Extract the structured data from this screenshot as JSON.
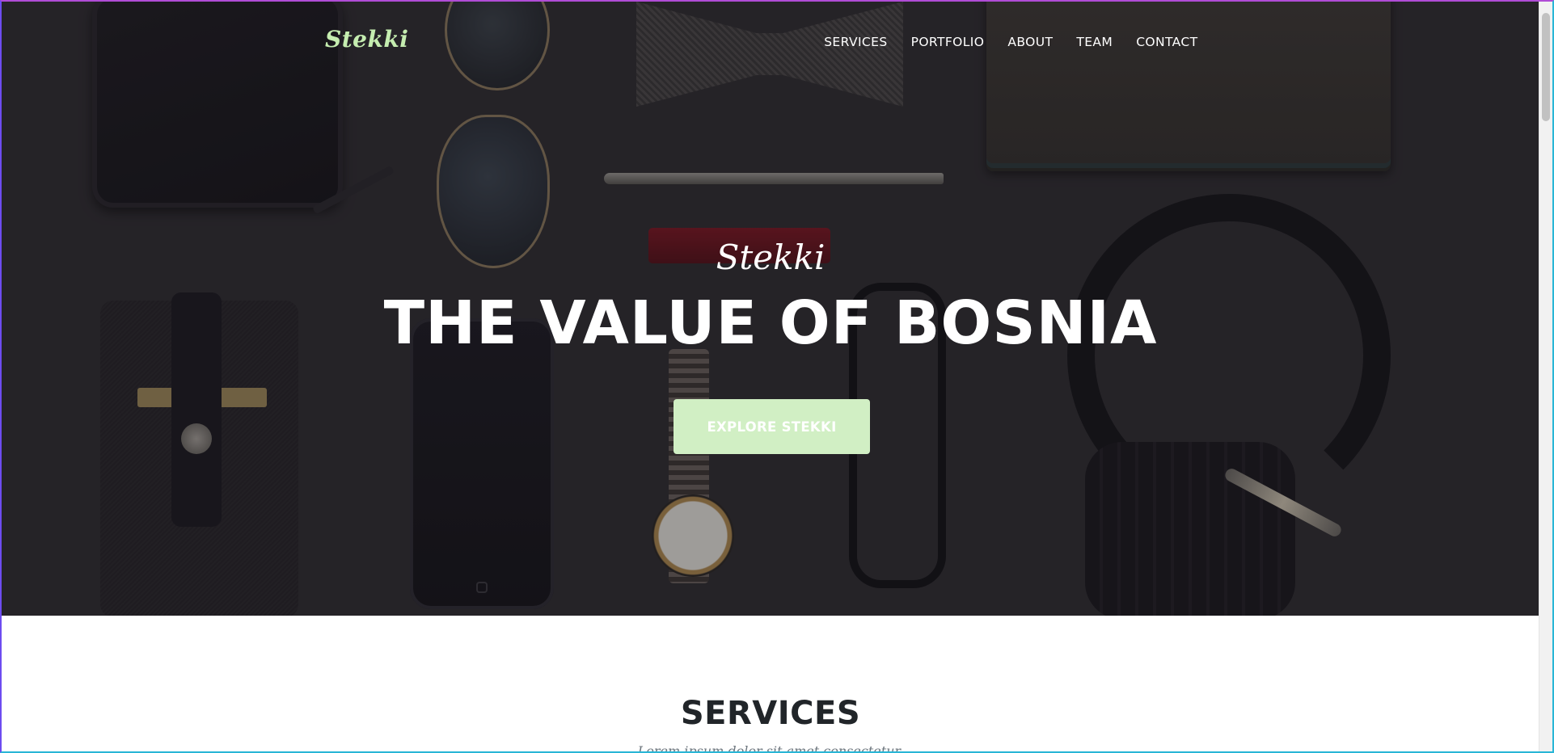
{
  "navbar": {
    "brand": "Stekki",
    "links": [
      {
        "label": "SERVICES"
      },
      {
        "label": "PORTFOLIO"
      },
      {
        "label": "ABOUT"
      },
      {
        "label": "TEAM"
      },
      {
        "label": "CONTACT"
      }
    ]
  },
  "hero": {
    "subheading": "Stekki",
    "heading": "THE VALUE OF BOSNIA",
    "button_label": "EXPLORE STEKKI"
  },
  "services": {
    "heading": "SERVICES",
    "subheading": "Lorem ipsum dolor sit amet consectetur."
  },
  "colors": {
    "accent": "#d1efc4",
    "brand": "#c5edb0",
    "heading_dark": "#212529"
  }
}
